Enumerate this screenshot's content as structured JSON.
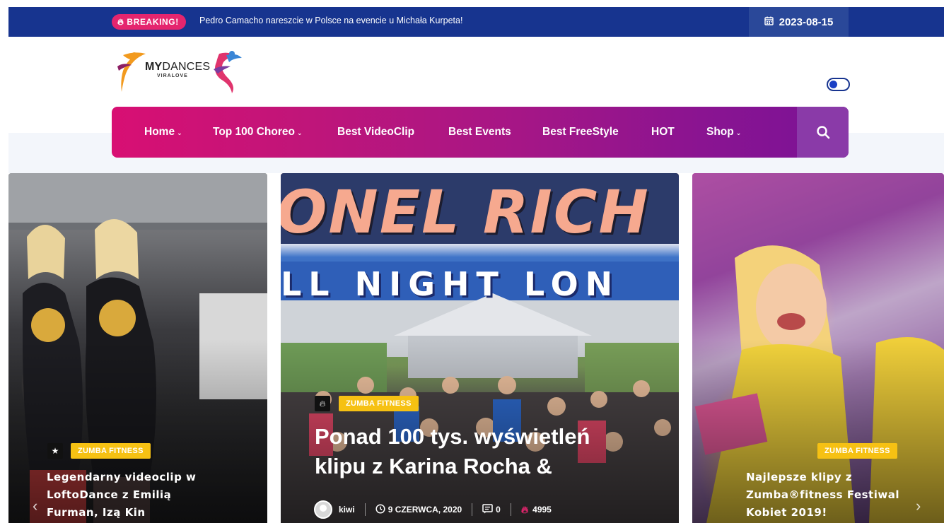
{
  "breaking": {
    "badge_label": "BREAKING!",
    "headline": "Pedro Camacho nareszcie w Polsce na evencie u Michała Kurpeta!",
    "date": "2023-08-15"
  },
  "logo": {
    "brand_bold": "MY",
    "brand_rest": "DANCES",
    "tagline": "VIRALOVE"
  },
  "nav": {
    "items": [
      {
        "label": "Home",
        "has_dropdown": true
      },
      {
        "label": "Top 100 Choreo",
        "has_dropdown": true
      },
      {
        "label": "Best VideoClip",
        "has_dropdown": false
      },
      {
        "label": "Best Events",
        "has_dropdown": false
      },
      {
        "label": "Best FreeStyle",
        "has_dropdown": false
      },
      {
        "label": "HOT",
        "has_dropdown": false
      },
      {
        "label": "Shop",
        "has_dropdown": true
      }
    ]
  },
  "cards": [
    {
      "category": "ZUMBA FITNESS",
      "title_lines": [
        "Legendarny videoclip w",
        "LoftoDance z Emilią",
        "Furman, Izą Kin"
      ]
    },
    {
      "category": "ZUMBA FITNESS",
      "poster_top": "ONEL RICH",
      "poster_band": "LL NIGHT LON",
      "title_lines": [
        "Ponad 100 tys. wyświetleń",
        "klipu z Karina Rocha &"
      ],
      "author": "kiwi",
      "date": "9 CZERWCA, 2020",
      "comments": "0",
      "views": "4995"
    },
    {
      "category": "ZUMBA FITNESS",
      "title_lines": [
        "Najlepsze klipy z",
        "Zumba®fitness Festiwal",
        "Kobiet 2019!"
      ]
    }
  ],
  "colors": {
    "topbar": "#17348f",
    "breaking_badge": "#e5256e",
    "nav_start": "#d80f73",
    "nav_end": "#7a1296",
    "tag": "#f6c113"
  }
}
